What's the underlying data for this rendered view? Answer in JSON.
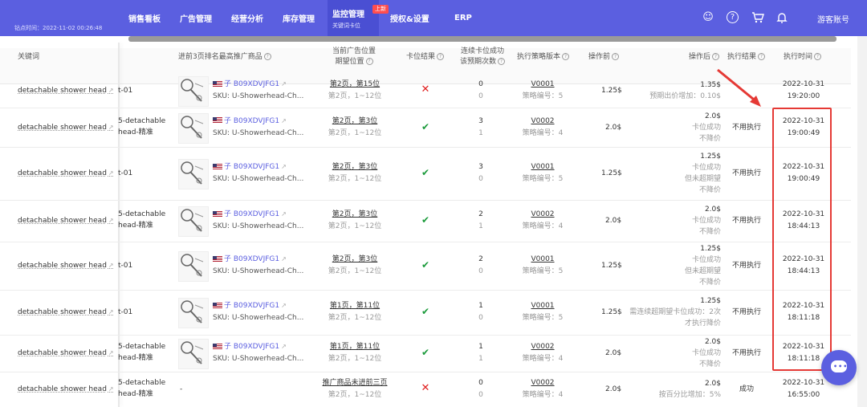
{
  "topbar": {
    "sync_time": "钻点时间：2022-11-02 00:26:48",
    "nav": [
      {
        "label": "销售看板"
      },
      {
        "label": "广告管理"
      },
      {
        "label": "经营分析"
      },
      {
        "label": "库存管理"
      },
      {
        "label": "监控管理",
        "sub": "关键词卡位",
        "badge": "上新"
      },
      {
        "label": "授权&设置"
      },
      {
        "label": "ERP"
      }
    ],
    "account": "游客账号"
  },
  "table": {
    "headers": {
      "keyword": "关键词",
      "product": "进前3页排名最高推广商品",
      "position": "当前广告位置",
      "position2": "期望位置",
      "result": "卡位结果",
      "continuous": "连续卡位成功",
      "continuous2": "该预期次数",
      "strategy": "执行策略版本",
      "before": "操作前",
      "after": "操作后",
      "exec_result": "执行结果",
      "exec_time": "执行时间"
    },
    "rows": [
      {
        "keyword": "detachable shower head",
        "group": "t-01",
        "group2": "",
        "asin": "子 B09XDVJFG1",
        "sku": "SKU: U-Showerhead-Ch...",
        "pos": "第2页，第15位",
        "pos_expect": "第2页，1~12位",
        "result": "fail",
        "count": "0",
        "count2": "0",
        "strategy": "V0001",
        "strategy_no": "策略编号：5",
        "before": "1.25$",
        "after": "1.35$",
        "after_notes": [
          "预期出价增加：0.10$"
        ],
        "exec": "",
        "date": "2022-10-31",
        "time": "19:20:00"
      },
      {
        "keyword": "detachable shower head",
        "group": "5-detachable",
        "group2": "head-精准",
        "asin": "子 B09XDVJFG1",
        "sku": "SKU: U-Showerhead-Ch...",
        "pos": "第2页，第3位",
        "pos_expect": "第2页，1~12位",
        "result": "ok",
        "count": "3",
        "count2": "1",
        "strategy": "V0002",
        "strategy_no": "策略编号：4",
        "before": "2.0$",
        "after": "2.0$",
        "after_notes": [
          "卡位成功",
          "不降价"
        ],
        "exec": "不用执行",
        "date": "2022-10-31",
        "time": "19:00:49"
      },
      {
        "keyword": "detachable shower head",
        "group": "t-01",
        "group2": "",
        "asin": "子 B09XDVJFG1",
        "sku": "SKU: U-Showerhead-Ch...",
        "pos": "第2页，第3位",
        "pos_expect": "第2页，1~12位",
        "result": "ok",
        "count": "3",
        "count2": "0",
        "strategy": "V0001",
        "strategy_no": "策略编号：5",
        "before": "1.25$",
        "after": "1.25$",
        "after_notes": [
          "卡位成功",
          "但未超期望",
          "不降价"
        ],
        "exec": "不用执行",
        "date": "2022-10-31",
        "time": "19:00:49"
      },
      {
        "keyword": "detachable shower head",
        "group": "5-detachable",
        "group2": "head-精准",
        "asin": "子 B09XDVJFG1",
        "sku": "SKU: U-Showerhead-Ch...",
        "pos": "第2页，第3位",
        "pos_expect": "第2页，1~12位",
        "result": "ok",
        "count": "2",
        "count2": "1",
        "strategy": "V0002",
        "strategy_no": "策略编号：4",
        "before": "2.0$",
        "after": "2.0$",
        "after_notes": [
          "卡位成功",
          "不降价"
        ],
        "exec": "不用执行",
        "date": "2022-10-31",
        "time": "18:44:13"
      },
      {
        "keyword": "detachable shower head",
        "group": "t-01",
        "group2": "",
        "asin": "子 B09XDVJFG1",
        "sku": "SKU: U-Showerhead-Ch...",
        "pos": "第2页，第3位",
        "pos_expect": "第2页，1~12位",
        "result": "ok",
        "count": "2",
        "count2": "0",
        "strategy": "V0001",
        "strategy_no": "策略编号：5",
        "before": "1.25$",
        "after": "1.25$",
        "after_notes": [
          "卡位成功",
          "但未超期望",
          "不降价"
        ],
        "exec": "不用执行",
        "date": "2022-10-31",
        "time": "18:44:13"
      },
      {
        "keyword": "detachable shower head",
        "group": "t-01",
        "group2": "",
        "asin": "子 B09XDVJFG1",
        "sku": "SKU: U-Showerhead-Ch...",
        "pos": "第1页，第11位",
        "pos_expect": "第2页，1~12位",
        "result": "ok",
        "count": "1",
        "count2": "0",
        "strategy": "V0001",
        "strategy_no": "策略编号：5",
        "before": "1.25$",
        "after": "1.25$",
        "after_notes": [
          "需连续超期望卡位成功：2次",
          "才执行降价"
        ],
        "exec": "不用执行",
        "date": "2022-10-31",
        "time": "18:11:18"
      },
      {
        "keyword": "detachable shower head",
        "group": "5-detachable",
        "group2": "head-精准",
        "asin": "子 B09XDVJFG1",
        "sku": "SKU: U-Showerhead-Ch...",
        "pos": "第1页，第11位",
        "pos_expect": "第2页，1~12位",
        "result": "ok",
        "count": "1",
        "count2": "1",
        "strategy": "V0002",
        "strategy_no": "策略编号：4",
        "before": "2.0$",
        "after": "2.0$",
        "after_notes": [
          "卡位成功",
          "不降价"
        ],
        "exec": "不用执行",
        "date": "2022-10-31",
        "time": "18:11:18"
      },
      {
        "keyword": "detachable shower head",
        "group": "5-detachable",
        "group2": "head-精准",
        "asin": "",
        "sku": "",
        "product_dash": "-",
        "pos": "推广商品未进前三页",
        "pos_expect": "第2页，1~12位",
        "result": "fail",
        "count": "0",
        "count2": "0",
        "strategy": "V0002",
        "strategy_no": "策略编号：4",
        "before": "2.0$",
        "after": "2.0$",
        "after_notes": [
          "按百分比增加：5%"
        ],
        "exec": "成功",
        "date": "2022-10-31",
        "time": "16:55:00"
      }
    ]
  },
  "colors": {
    "primary": "#5b5fe0",
    "highlight": "#e53935",
    "ok": "#1a9a3a",
    "fail": "#e02020"
  },
  "icons": [
    "user-icon",
    "help-icon",
    "cart-icon",
    "bell-icon",
    "chat-icon",
    "external-link-icon",
    "us-flag-icon"
  ]
}
